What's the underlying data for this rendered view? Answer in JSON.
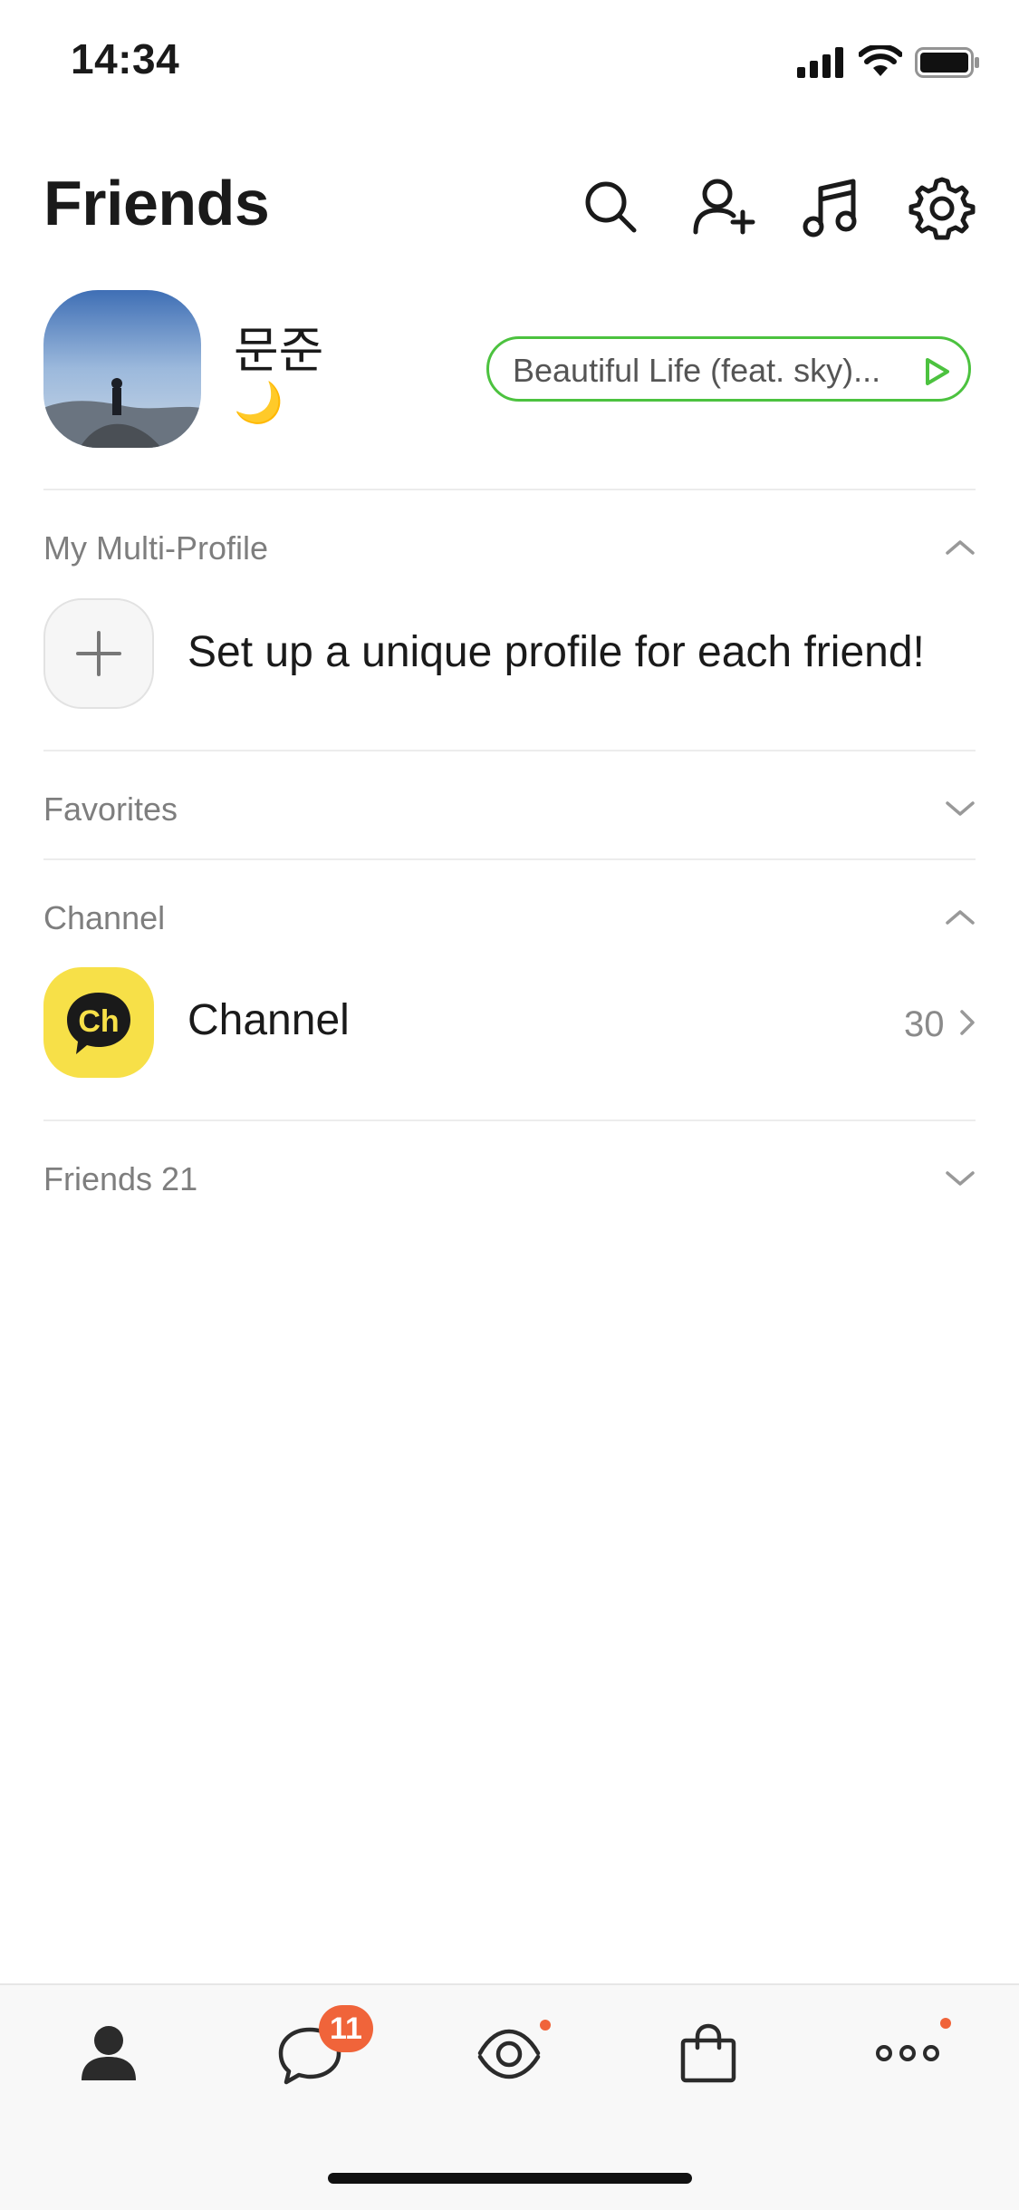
{
  "status_bar": {
    "time": "14:34"
  },
  "header": {
    "title": "Friends",
    "icons": [
      "search-icon",
      "add-friend-icon",
      "music-icon",
      "settings-icon"
    ]
  },
  "profile": {
    "name": "문준",
    "status": "🌙",
    "music": {
      "label": "Beautiful Life (feat. sky)...",
      "accent": "#4cc23f"
    }
  },
  "sections": {
    "multi_profile": {
      "label": "My Multi-Profile",
      "prompt": "Set up a unique profile for each friend!"
    },
    "favorites": {
      "label": "Favorites"
    },
    "channel": {
      "label": "Channel",
      "item_name": "Channel",
      "item_logo": "Ch",
      "count": "30"
    },
    "friends": {
      "label": "Friends 21"
    }
  },
  "tabbar": {
    "tabs": [
      "friends-tab",
      "chats-tab",
      "view-tab",
      "shopping-tab",
      "more-tab"
    ],
    "chat_badge": "11",
    "badge_color": "#f0643a"
  }
}
